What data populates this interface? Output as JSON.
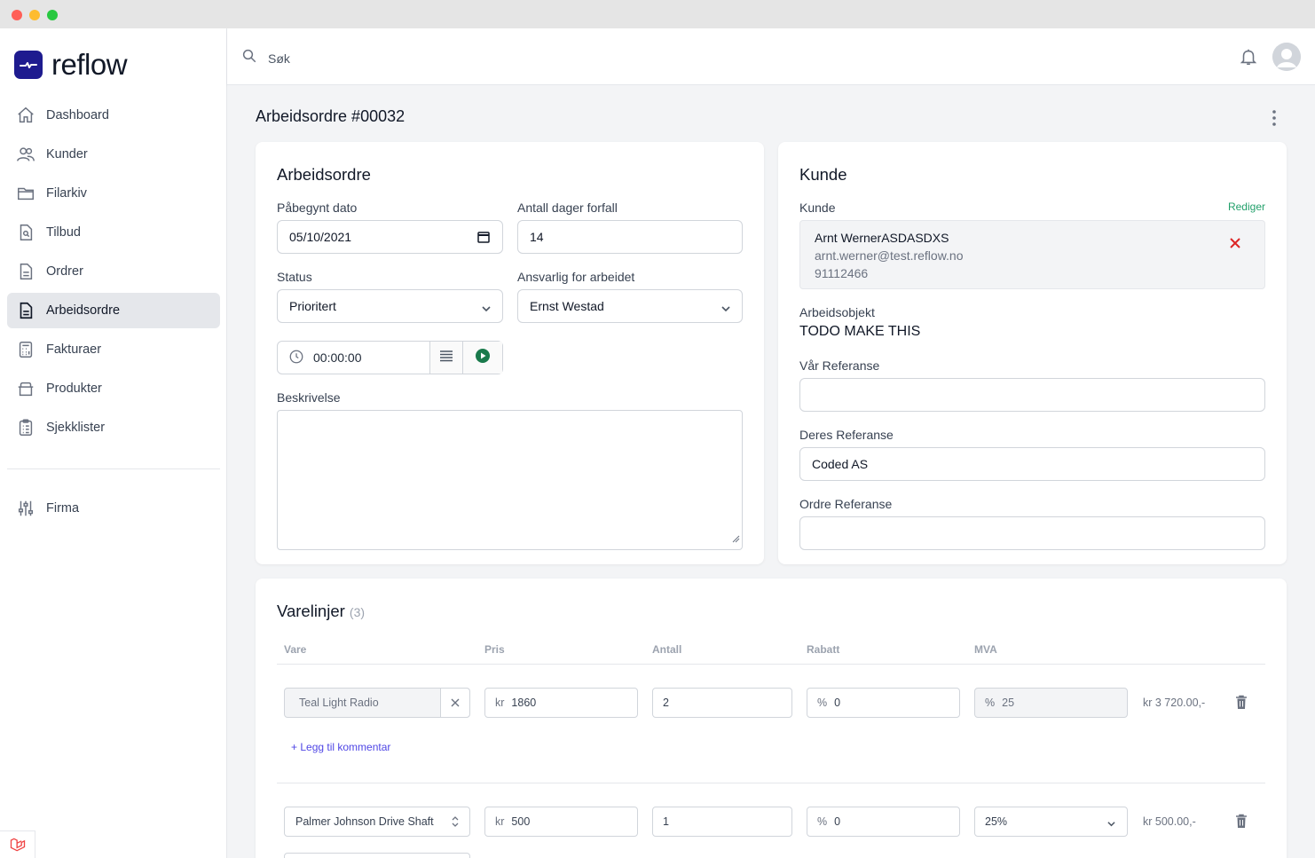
{
  "app": {
    "name": "reflow"
  },
  "sidebar": {
    "items": [
      {
        "label": "Dashboard",
        "icon": "home-icon"
      },
      {
        "label": "Kunder",
        "icon": "users-icon"
      },
      {
        "label": "Filarkiv",
        "icon": "folder-icon"
      },
      {
        "label": "Tilbud",
        "icon": "document-search-icon"
      },
      {
        "label": "Ordrer",
        "icon": "document-text-icon"
      },
      {
        "label": "Arbeidsordre",
        "icon": "document-icon",
        "active": true
      },
      {
        "label": "Fakturaer",
        "icon": "calculator-icon"
      },
      {
        "label": "Produkter",
        "icon": "archive-icon"
      },
      {
        "label": "Sjekklister",
        "icon": "clipboard-list-icon"
      }
    ],
    "footer_item": {
      "label": "Firma",
      "icon": "adjustments-icon"
    }
  },
  "topbar": {
    "search_label": "Søk"
  },
  "page": {
    "title": "Arbeidsordre #00032"
  },
  "workorder": {
    "heading": "Arbeidsordre",
    "start_date_label": "Påbegynt dato",
    "start_date_value": "05/10/2021",
    "due_days_label": "Antall dager forfall",
    "due_days_value": "14",
    "status_label": "Status",
    "status_value": "Prioritert",
    "responsible_label": "Ansvarlig for arbeidet",
    "responsible_value": "Ernst Westad",
    "timer_value": "00:00:00",
    "description_label": "Beskrivelse",
    "description_value": ""
  },
  "customer": {
    "heading": "Kunde",
    "customer_label": "Kunde",
    "edit_label": "Rediger",
    "name": "Arnt WernerASDASDXS",
    "email": "arnt.werner@test.reflow.no",
    "phone": "91112466",
    "work_object_label": "Arbeidsobjekt",
    "work_object_value": "TODO MAKE THIS",
    "our_ref_label": "Vår Referanse",
    "our_ref_value": "",
    "their_ref_label": "Deres Referanse",
    "their_ref_value": "Coded AS",
    "order_ref_label": "Ordre Referanse",
    "order_ref_value": ""
  },
  "lines": {
    "heading": "Varelinjer",
    "count": "(3)",
    "columns": [
      "Vare",
      "Pris",
      "Antall",
      "Rabatt",
      "MVA"
    ],
    "add_comment_label": "+ Legg til kommentar",
    "rows": [
      {
        "product": "Teal Light Radio",
        "currency": "kr",
        "price": "1860",
        "qty": "2",
        "discount_prefix": "%",
        "discount": "0",
        "vat_prefix": "%",
        "vat": "25",
        "total": "kr 3 720.00,-"
      },
      {
        "product": "Palmer Johnson Drive Shaft",
        "currency": "kr",
        "price": "500",
        "qty": "1",
        "discount_prefix": "%",
        "discount": "0",
        "vat": "25%",
        "total": "kr 500.00,-"
      }
    ]
  },
  "colors": {
    "brand": "#1e1b8f",
    "accent_green": "#22a06b",
    "danger": "#dc2626",
    "link": "#4f46e5",
    "play": "#1a7a4c"
  }
}
